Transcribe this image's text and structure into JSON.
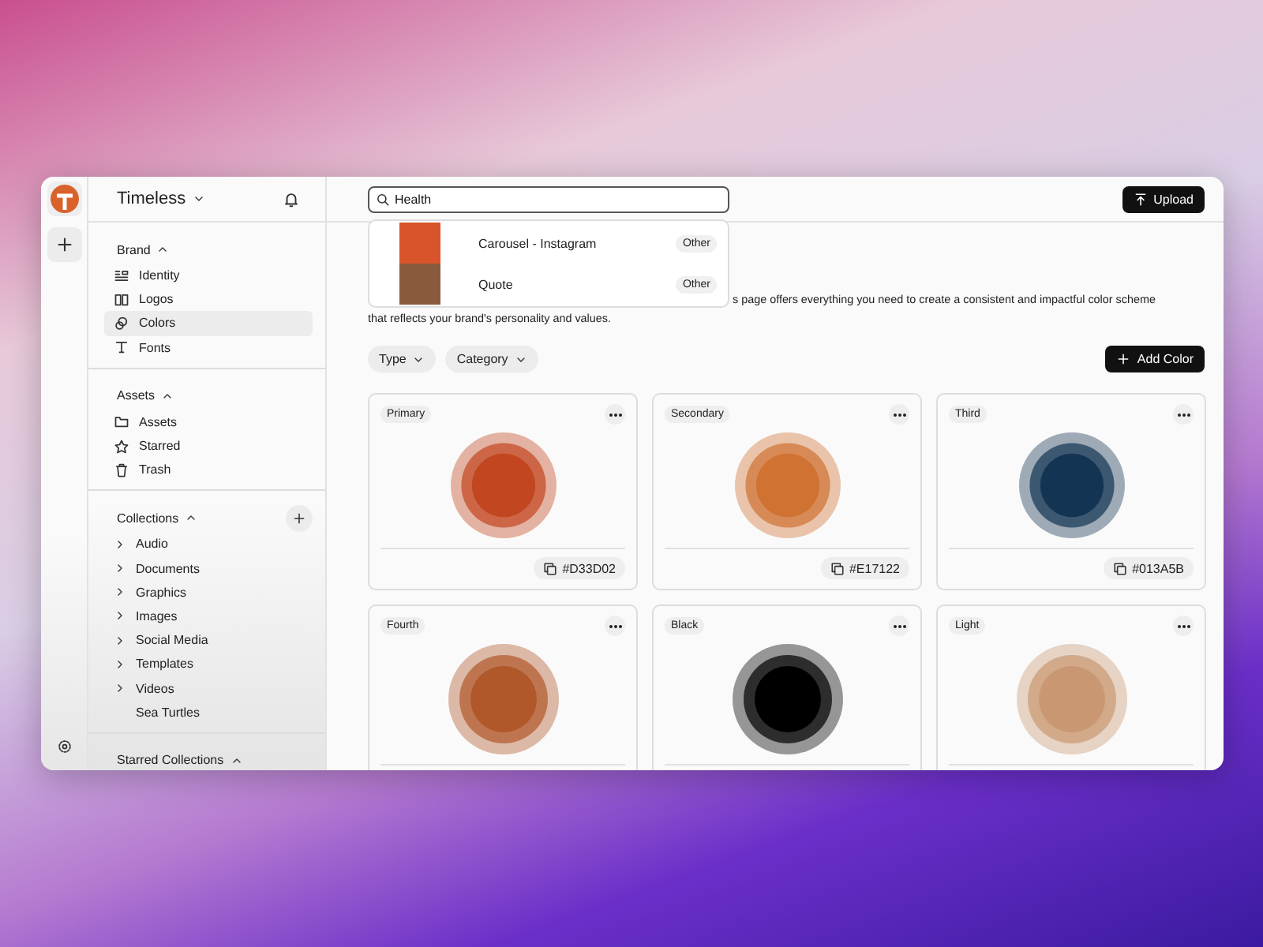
{
  "workspace": {
    "name": "Timeless"
  },
  "sidebar": {
    "sections": [
      {
        "title": "Brand",
        "expanded": true,
        "items": [
          {
            "label": "Identity",
            "selected": false
          },
          {
            "label": "Logos",
            "selected": false
          },
          {
            "label": "Colors",
            "selected": true
          },
          {
            "label": "Fonts",
            "selected": false
          }
        ]
      },
      {
        "title": "Assets",
        "expanded": true,
        "items": [
          {
            "label": "Assets",
            "selected": false
          },
          {
            "label": "Starred",
            "selected": false
          },
          {
            "label": "Trash",
            "selected": false
          }
        ]
      },
      {
        "title": "Collections",
        "expanded": true,
        "add_button": true,
        "items": [
          {
            "label": "Audio",
            "selected": false,
            "expandable": true
          },
          {
            "label": "Documents",
            "selected": false,
            "expandable": true
          },
          {
            "label": "Graphics",
            "selected": false,
            "expandable": true
          },
          {
            "label": "Images",
            "selected": false,
            "expandable": true
          },
          {
            "label": "Social Media",
            "selected": false,
            "expandable": true
          },
          {
            "label": "Templates",
            "selected": false,
            "expandable": true
          },
          {
            "label": "Videos",
            "selected": false,
            "expandable": true
          },
          {
            "label": "Sea Turtles",
            "selected": false,
            "expandable": false
          }
        ]
      },
      {
        "title": "Starred Collections",
        "expanded": true
      }
    ]
  },
  "search": {
    "value": "Health",
    "results": [
      {
        "title": "Carousel - Instagram",
        "tag": "Other",
        "color": "#d9542a"
      },
      {
        "title": "Quote",
        "tag": "Other",
        "color": "#8a5a3c"
      }
    ]
  },
  "upload_button": "Upload",
  "description": [
    "s page offers everything you need to create a consistent and impactful color scheme",
    "that reflects your brand's personality and values."
  ],
  "filters": [
    "Type",
    "Category"
  ],
  "add_button": "Add Color",
  "cards": [
    {
      "label": "Primary",
      "color": "#c2461f",
      "hex": "#D33D02"
    },
    {
      "label": "Secondary",
      "color": "#cf7232",
      "hex": "#E17122"
    },
    {
      "label": "Third",
      "color": "#133553",
      "hex": "#013A5B"
    },
    {
      "label": "Fourth",
      "color": "#b0582a"
    },
    {
      "label": "Black",
      "color": "#000000"
    },
    {
      "label": "Light",
      "color": "#c99872"
    }
  ]
}
